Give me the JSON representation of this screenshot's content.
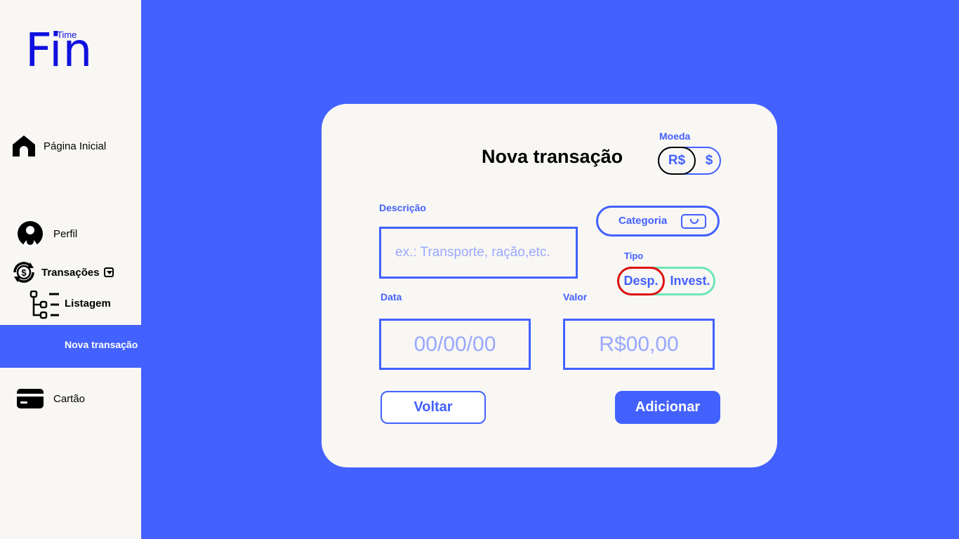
{
  "logo": {
    "main": "Fin",
    "sub": "Time"
  },
  "sidebar": {
    "items": [
      {
        "label": "Página Inicial",
        "icon": "home-icon"
      },
      {
        "label": "Perfil",
        "icon": "user-icon"
      },
      {
        "label": "Transações",
        "icon": "transactions-icon"
      },
      {
        "label": "Listagem",
        "icon": "list-tree-icon"
      },
      {
        "label": "Nova transação",
        "active": true
      },
      {
        "label": "Cartão",
        "icon": "credit-card-icon"
      }
    ]
  },
  "form": {
    "title": "Nova transação",
    "currency": {
      "label": "Moeda",
      "options": [
        "R$",
        "$"
      ],
      "selected": "R$"
    },
    "description": {
      "label": "Descrição",
      "placeholder": "ex.: Transporte, ração,etc."
    },
    "category": {
      "label": "Categoria"
    },
    "type": {
      "label": "Tipo",
      "options": [
        "Desp.",
        "Invest."
      ],
      "selected": "Desp."
    },
    "date": {
      "label": "Data",
      "placeholder": "00/00/00"
    },
    "value": {
      "label": "Valor",
      "placeholder": "R$00,00"
    },
    "buttons": {
      "back": "Voltar",
      "add": "Adicionar"
    }
  },
  "colors": {
    "accent": "#4361ff",
    "background": "#f8f7f4",
    "selected_currency_border": "#000000",
    "expense_border": "#e01010",
    "invest_border": "#6ee7b7"
  }
}
